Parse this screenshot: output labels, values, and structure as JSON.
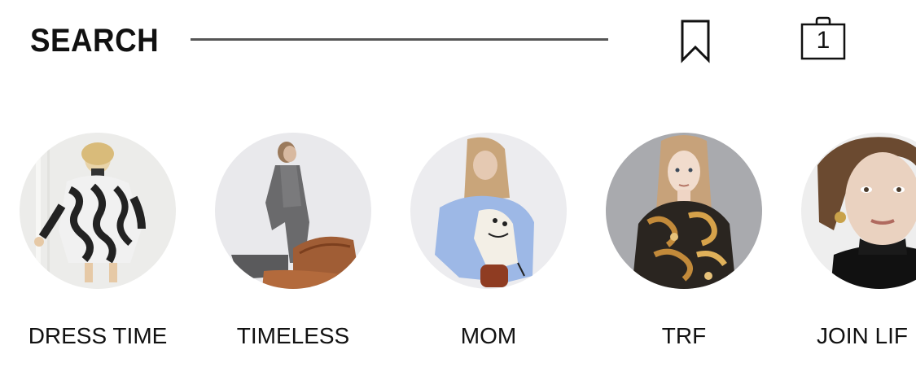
{
  "header": {
    "title": "SEARCH",
    "bookmark_icon": "bookmark-icon",
    "bag_icon": "shopping-bag-icon",
    "bag_count": "1"
  },
  "categories": [
    {
      "label": "DRESS TIME",
      "image": "model-zebra-print-coat-photo"
    },
    {
      "label": "TIMELESS",
      "image": "model-grey-suit-leather-chair-photo"
    },
    {
      "label": "MOM",
      "image": "model-blue-sweater-photo"
    },
    {
      "label": "TRF",
      "image": "model-paisley-blouse-photo"
    },
    {
      "label": "JOIN LIF",
      "image": "model-portrait-photo"
    }
  ],
  "colors": {
    "text": "#111111",
    "divider": "#555555",
    "background": "#ffffff"
  }
}
